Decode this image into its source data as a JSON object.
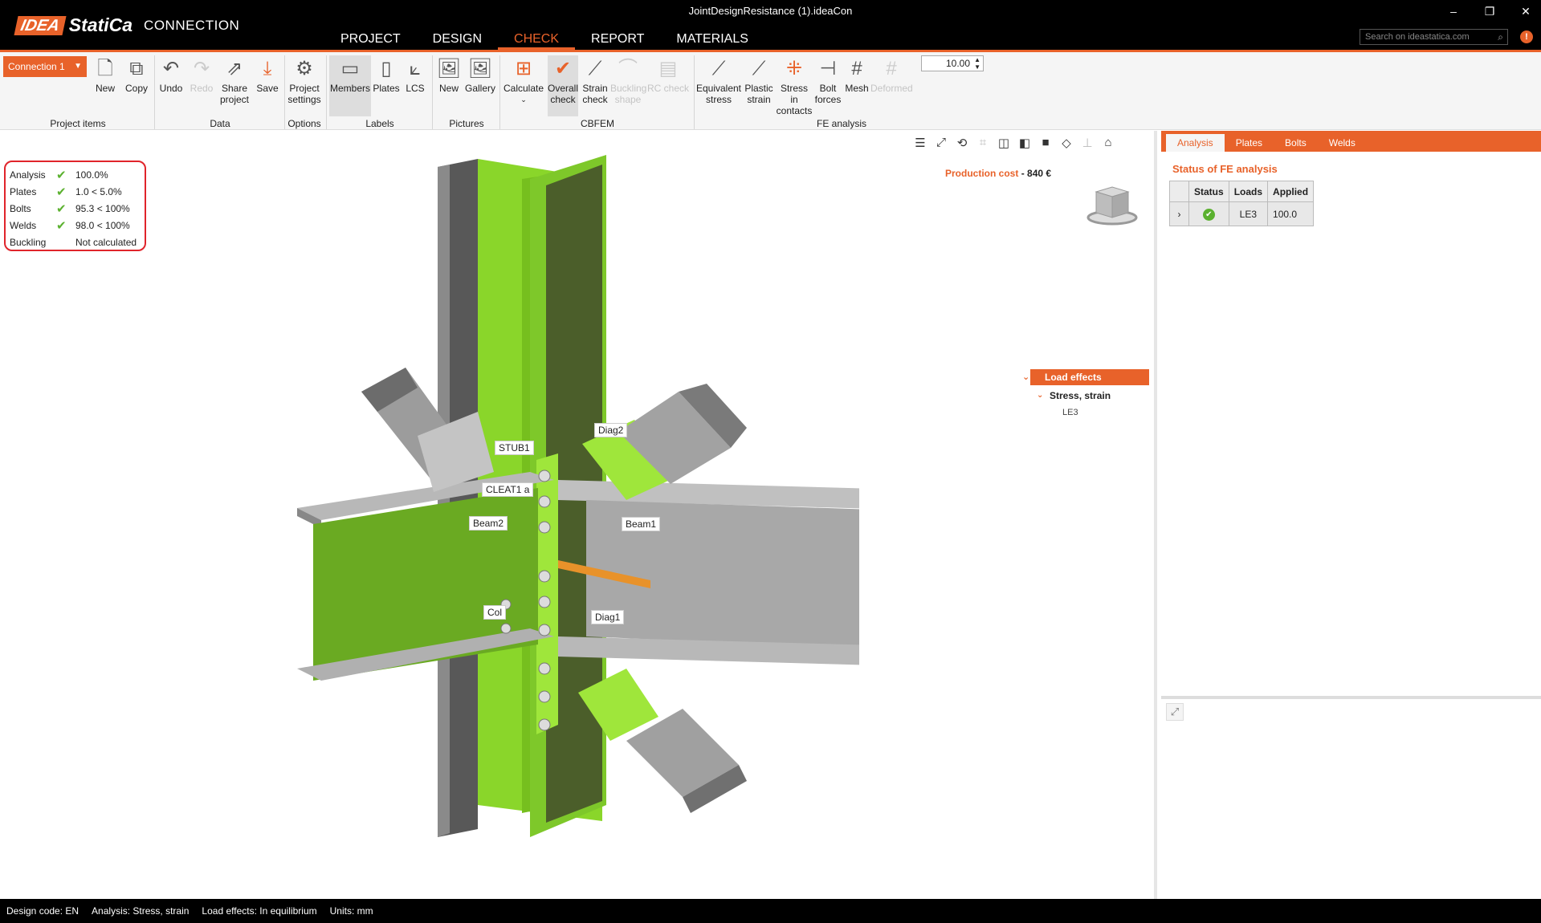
{
  "window": {
    "title": "JointDesignResistance (1).ideaCon",
    "minimize": "–",
    "restore": "❐",
    "close": "✕"
  },
  "logo": {
    "brand": "IDEA",
    "name": "StatiCa",
    "product": "CONNECTION"
  },
  "menu": [
    "PROJECT",
    "DESIGN",
    "CHECK",
    "REPORT",
    "MATERIALS"
  ],
  "menu_active": "CHECK",
  "search": {
    "placeholder": "Search on ideastatica.com"
  },
  "ribbon": {
    "connection_select": "Connection 1",
    "buttons": {
      "new": "New",
      "copy": "Copy",
      "undo": "Undo",
      "redo": "Redo",
      "share": "Share project",
      "save": "Save",
      "project_settings": "Project settings",
      "members": "Members",
      "plates": "Plates",
      "lcs": "LCS",
      "pic_new": "New",
      "gallery": "Gallery",
      "calculate": "Calculate",
      "overall_check": "Overall check",
      "strain_check": "Strain check",
      "buckling_shape": "Buckling shape",
      "rc_check": "RC check",
      "equivalent_stress": "Equivalent stress",
      "plastic_strain": "Plastic strain",
      "stress_contacts": "Stress in contacts",
      "bolt_forces": "Bolt forces",
      "mesh": "Mesh",
      "deformed": "Deformed"
    },
    "groups": {
      "project_items": "Project items",
      "data": "Data",
      "options": "Options",
      "labels": "Labels",
      "pictures": "Pictures",
      "cbfem": "CBFEM",
      "fe_analysis": "FE analysis"
    },
    "zoom_value": "10.00"
  },
  "summary": [
    {
      "label": "Analysis",
      "ok": true,
      "value": "100.0%"
    },
    {
      "label": "Plates",
      "ok": true,
      "value": "1.0 < 5.0%"
    },
    {
      "label": "Bolts",
      "ok": true,
      "value": "95.3 < 100%"
    },
    {
      "label": "Welds",
      "ok": true,
      "value": "98.0 < 100%"
    },
    {
      "label": "Buckling",
      "ok": false,
      "value": "Not calculated"
    }
  ],
  "production_cost": {
    "label": "Production cost",
    "value": "- 840 €"
  },
  "tree": {
    "root": "Load effects",
    "child": "Stress, strain",
    "leaf": "LE3"
  },
  "members": {
    "stub1": "STUB1",
    "cleat": "CLEAT1 a",
    "beam2": "Beam2",
    "beam1": "Beam1",
    "col": "Col",
    "diag1": "Diag1",
    "diag2": "Diag2"
  },
  "right_panel": {
    "tabs": [
      "Analysis",
      "Plates",
      "Bolts",
      "Welds"
    ],
    "title": "Status of FE analysis",
    "columns": [
      "Status",
      "Loads",
      "Applied"
    ],
    "rows": [
      {
        "load": "LE3",
        "applied": "100.0"
      }
    ]
  },
  "statusbar": {
    "design_code": "Design code: EN",
    "analysis": "Analysis: Stress, strain",
    "load_effects": "Load effects: In equilibrium",
    "units": "Units: mm"
  },
  "colors": {
    "accent": "#e8622a",
    "plate_green": "#8ad62a",
    "steel_grey": "#a9a9a9",
    "ok_green": "#5bb12f",
    "summary_border": "#e0242b"
  }
}
